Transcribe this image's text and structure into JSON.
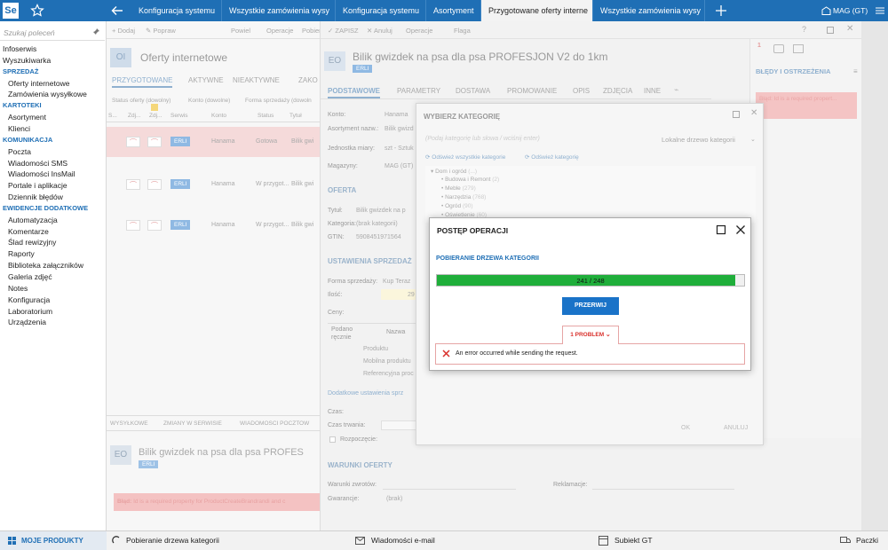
{
  "app": {
    "logo": "Se"
  },
  "tabs": [
    "Konfiguracja systemu",
    "Wszystkie zamówienia wysy",
    "Konfiguracja systemu",
    "Asortyment",
    "Przygotowane oferty interne",
    "Wszystkie zamówienia wysy"
  ],
  "topbar": {
    "warehouse": "MAG (GT)"
  },
  "sidebar": {
    "search_placeholder": "Szukaj poleceń",
    "items": [
      {
        "t": "item",
        "label": "Infoserwis"
      },
      {
        "t": "item",
        "label": "Wyszukiwarka"
      },
      {
        "t": "section",
        "label": "SPRZEDAŻ"
      },
      {
        "t": "sub",
        "label": "Oferty internetowe"
      },
      {
        "t": "sub",
        "label": "Zamówienia wysyłkowe"
      },
      {
        "t": "section",
        "label": "KARTOTEKI"
      },
      {
        "t": "sub",
        "label": "Asortyment"
      },
      {
        "t": "sub",
        "label": "Klienci"
      },
      {
        "t": "section",
        "label": "KOMUNIKACJA"
      },
      {
        "t": "sub",
        "label": "Poczta"
      },
      {
        "t": "sub",
        "label": "Wiadomości SMS"
      },
      {
        "t": "sub",
        "label": "Wiadomości InsMail"
      },
      {
        "t": "sub",
        "label": "Portale i aplikacje"
      },
      {
        "t": "sub",
        "label": "Dziennik błędów"
      },
      {
        "t": "section",
        "label": "EWIDENCJE DODATKOWE"
      },
      {
        "t": "sub",
        "label": "Automatyzacja"
      },
      {
        "t": "sub",
        "label": "Komentarze"
      },
      {
        "t": "sub",
        "label": "Ślad rewizyjny"
      },
      {
        "t": "sub",
        "label": "Raporty"
      },
      {
        "t": "sub",
        "label": "Biblioteka załączników"
      },
      {
        "t": "sub",
        "label": "Galeria zdjęć"
      },
      {
        "t": "sub",
        "label": "Notes"
      },
      {
        "t": "sub",
        "label": "Konfiguracja"
      },
      {
        "t": "sub",
        "label": "Laboratorium"
      },
      {
        "t": "sub",
        "label": "Urządzenia"
      }
    ]
  },
  "bottombar": {
    "my_products": "MOJE PRODUKTY",
    "task": "Pobieranie drzewa kategorii",
    "email": "Wiadomości e-mail",
    "subiekt": "Subiekt GT",
    "paczki": "Paczki"
  },
  "list": {
    "toolbar": [
      "Dodaj",
      "Popraw",
      "Powiel",
      "Operacje",
      "Pobierz"
    ],
    "icon": "OI",
    "title": "Oferty internetowe",
    "tabs": [
      "PRZYGOTOWANE",
      "AKTYWNE",
      "NIEAKTYWNE",
      "ZAKO"
    ],
    "filters": [
      "Status oferty (dowolny)",
      "Konto (dowolne)",
      "Forma sprzedaży (dowoln"
    ],
    "columns": [
      "S...",
      "Zdj...",
      "Zdj...",
      "Serwis",
      "Konto",
      "Status",
      "Tytuł"
    ],
    "rows": [
      {
        "badge": "ERLI",
        "account": "Hanama",
        "status": "Gotowa",
        "title": "Bilik gwi"
      },
      {
        "badge": "ERLI",
        "account": "Hanama",
        "status": "W przygot...",
        "title": "Bilik gwi"
      },
      {
        "badge": "ERLI",
        "account": "Hanama",
        "status": "W przygot...",
        "title": "Bilik gwi"
      }
    ],
    "bottom_tabs": [
      "WYSYŁKOWE",
      "ZMIANY W SERWISIE",
      "WIADOMOŚCI POCZTOW"
    ],
    "preview_icon": "EO",
    "preview_title": "Bilik gwizdek na psa dla psa PROFES",
    "preview_badge": "ERLI",
    "error_label": "Błąd:",
    "error_text": "Id is a required property for ProductCreateBrandrandi and c"
  },
  "offer": {
    "toolbar": [
      "ZAPISZ",
      "Anuluj",
      "Operacje",
      "Flaga"
    ],
    "icon": "EO",
    "title": "Bilik gwizdek na psa dla psa PROFESJON V2 do 1km",
    "badge": "ERLI",
    "tabs": [
      "PODSTAWOWE",
      "PARAMETRY",
      "DOSTAWA",
      "PROMOWANIE",
      "OPIS",
      "ZDJĘCIA",
      "INNE"
    ],
    "fields": [
      {
        "label": "Konto:",
        "value": "Hanama"
      },
      {
        "label": "Asortyment nazw.:",
        "value": "Bilik gwizd"
      },
      {
        "label": "Jednostka miary:",
        "value": "szt - Sztuk"
      },
      {
        "label": "Magazyny:",
        "value": "MAG (GT)"
      }
    ],
    "section_offer": "OFERTA",
    "offer_fields": [
      {
        "label": "Tytuł:",
        "value": "Bilik gwizdek na p"
      },
      {
        "label": "Kategoria:",
        "value": "(brak kategorii)"
      },
      {
        "label": "GTIN:",
        "value": "5908451971564"
      }
    ],
    "section_sales": "USTAWIENIA SPRZEDAŻ",
    "sale_form_label": "Forma sprzedaży:",
    "sale_form_value": "Kup Teraz",
    "qty_label": "Ilość:",
    "qty_value": "29",
    "prices_label": "Ceny:",
    "price_cols": [
      "Podano ręcznie",
      "Nazwa"
    ],
    "price_rows": [
      "Produktu",
      "Mobilna produktu",
      "Referencyjna proc"
    ],
    "extra_link": "Dodatkowe ustawienia sprz",
    "time_label": "Czas:",
    "duration_label": "Czas trwania:",
    "start_label": "Rozpoczęcie:",
    "section_terms": "WARUNKI OFERTY",
    "returns_label": "Warunki zwrotów:",
    "claims_label": "Reklamacje:",
    "warranty_label": "Gwarancje:",
    "warranty_value": "(brak)"
  },
  "errors_panel": {
    "title": "BŁĘDY I OSTRZEŻENIA",
    "text": "Błąd: Id is a required propert...",
    "count": "1"
  },
  "category_dialog": {
    "title": "WYBIERZ KATEGORIĘ",
    "search_placeholder": "(Podaj kategorię lub słowa / wciśnij enter)",
    "source": "Lokalne drzewo kategorii",
    "link1": "Odśwież wszystkie kategorie",
    "link2": "Odśwież kategorię",
    "tree": [
      {
        "label": "Dom i ogród",
        "count": "(...)",
        "indent": 0
      },
      {
        "label": "Budowa i Remont",
        "count": "(2)",
        "indent": 1
      },
      {
        "label": "Meble",
        "count": "(279)",
        "indent": 1
      },
      {
        "label": "Narzędzia",
        "count": "(768)",
        "indent": 1
      },
      {
        "label": "Ogród",
        "count": "(90)",
        "indent": 1
      },
      {
        "label": "Oświetlenie",
        "count": "(60)",
        "indent": 1
      }
    ],
    "ok": "OK",
    "cancel": "ANULUJ"
  },
  "progress_dialog": {
    "title": "POSTĘP OPERACJI",
    "subtitle": "POBIERANIE DRZEWA KATEGORII",
    "progress_text": "241 / 248",
    "progress_fraction": 0.9718,
    "stop_button": "PRZERWIJ",
    "problem_tab": "1 PROBLEM",
    "error_message": "An error occurred while sending the request."
  },
  "colors": {
    "accent": "#1f6fb5",
    "progress": "#1fae3a",
    "error": "#d9302b",
    "button": "#1a73c8"
  }
}
